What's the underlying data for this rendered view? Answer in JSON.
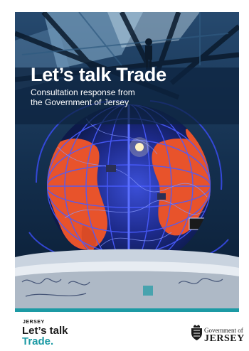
{
  "cover": {
    "title": "Let’s talk Trade",
    "subtitle_line1": "Consultation response from",
    "subtitle_line2": "the Government of Jersey",
    "image": {
      "description_icon": "globe-sculpture-photo",
      "accent_color": "#e8532b",
      "background_color": "#0b2240"
    }
  },
  "footer": {
    "brand_small": "JERSEY",
    "brand_line1": "Let’s talk",
    "brand_line2": "Trade.",
    "brand_accent": "#1c9aa4",
    "government_line1": "Government of",
    "government_line2": "JERSEY",
    "crest_icon": "jersey-crest-icon"
  }
}
